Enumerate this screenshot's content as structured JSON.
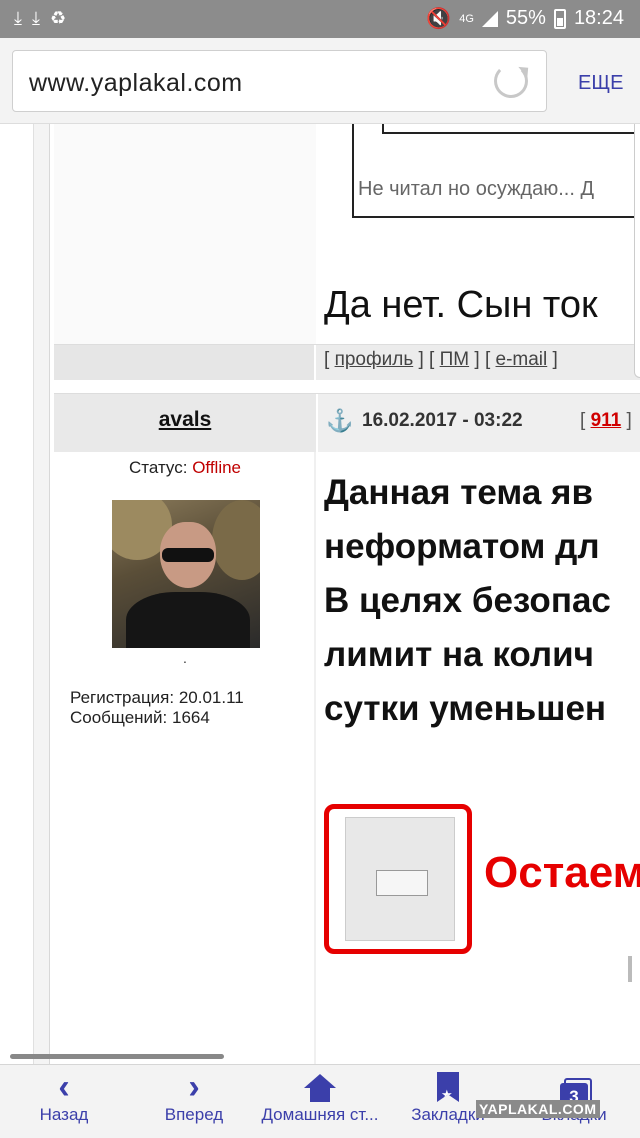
{
  "statusbar": {
    "network": "4G",
    "battery": "55%",
    "time": "18:24"
  },
  "browser": {
    "url": "www.yaplakal.com",
    "more_label": "ЕЩЕ"
  },
  "prev_post": {
    "quote_text": "Не читал но осуждаю... Д",
    "text": "Да нет. Сын ток",
    "links": {
      "open1": "[",
      "profile": "профиль",
      "sep1": "] [",
      "pm": "ПМ",
      "sep2": "] [",
      "email": "e-mail",
      "close": "]"
    }
  },
  "post": {
    "author": "avals",
    "status_label": "Статус:",
    "status_value": "Offline",
    "avatar_caption": ".",
    "registration": "Регистрация: 20.01.11",
    "messages": "Сообщений: 1664",
    "date": "16.02.2017 - 03:22",
    "num_open": "[",
    "num": "911",
    "num_close": "]",
    "lines": [
      "Данная тема яв",
      "неформатом дл",
      "В целях безопас",
      "лимит на колич",
      "сутки уменьшен"
    ],
    "banner_text": "Остаем"
  },
  "bottomnav": {
    "back": "Назад",
    "forward": "Вперед",
    "home": "Домашняя ст...",
    "bookmarks": "Закладки",
    "tabs": "Вкладки",
    "tabs_count": "3"
  },
  "watermark": "YAPLAKAL.COM",
  "colors": {
    "accent": "#3b3faa",
    "offline": "#c00000",
    "post_number": "#d00000",
    "banner_red": "#e60000"
  }
}
